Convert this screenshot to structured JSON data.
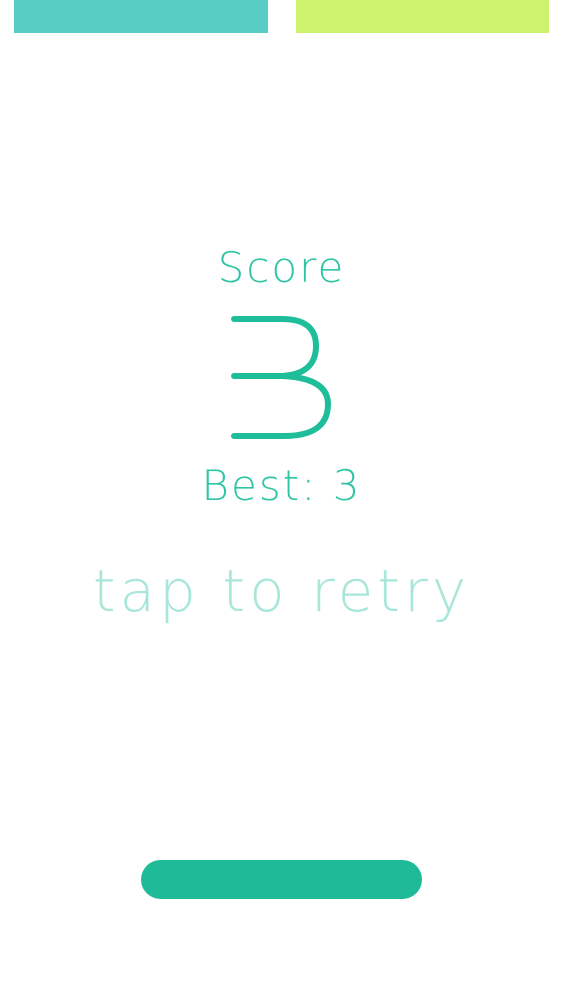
{
  "colors": {
    "bar_left": "#57CDC4",
    "bar_right": "#CDF36E",
    "score_text": "#2EC4A4",
    "score_number": "#1FBE9A",
    "retry_text": "#A8E6DA",
    "pill": "#1FBB98"
  },
  "game": {
    "score_label": "Score",
    "score_value": "3",
    "best_label": "Best: 3",
    "retry_label": "tap to retry"
  }
}
